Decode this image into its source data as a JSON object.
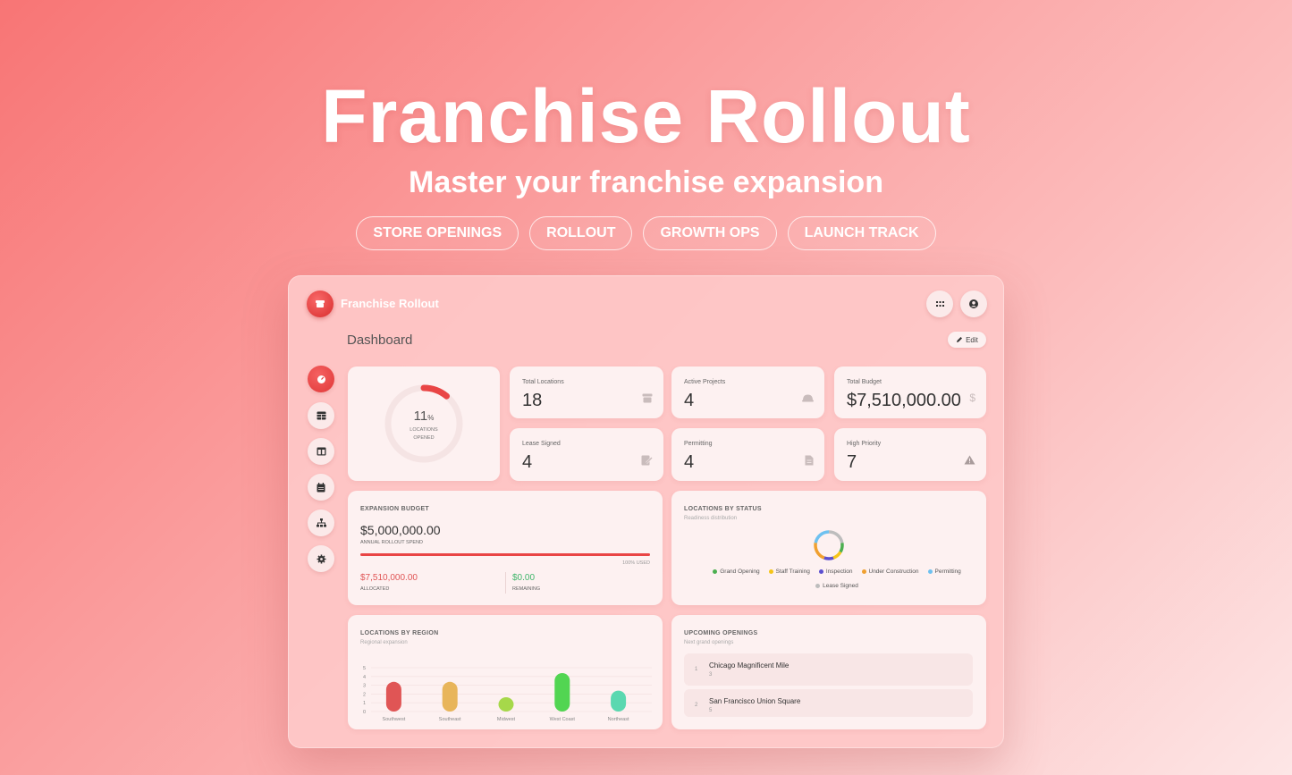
{
  "hero": {
    "title": "Franchise Rollout",
    "subtitle": "Master your franchise expansion",
    "tags": [
      "STORE OPENINGS",
      "ROLLOUT",
      "GROWTH OPS",
      "LAUNCH TRACK"
    ]
  },
  "app": {
    "title": "Franchise Rollout",
    "page_title": "Dashboard",
    "edit_label": "Edit"
  },
  "sidebar": {
    "items": [
      {
        "icon": "dashboard-icon",
        "active": true
      },
      {
        "icon": "table-icon",
        "active": false
      },
      {
        "icon": "board-icon",
        "active": false
      },
      {
        "icon": "calendar-icon",
        "active": false
      },
      {
        "icon": "hierarchy-icon",
        "active": false
      },
      {
        "icon": "settings-icon",
        "active": false
      }
    ]
  },
  "progress": {
    "value": "11",
    "unit": "%",
    "label_line1": "LOCATIONS",
    "label_line2": "OPENED",
    "fraction": 0.11
  },
  "stats": [
    {
      "label": "Total Locations",
      "value": "18",
      "icon": "store-icon"
    },
    {
      "label": "Active Projects",
      "value": "4",
      "icon": "hardhat-icon"
    },
    {
      "label": "Total Budget",
      "value": "$7,510,000.00",
      "icon": "dollar-icon"
    },
    {
      "label": "Lease Signed",
      "value": "4",
      "icon": "signature-icon"
    },
    {
      "label": "Permitting",
      "value": "4",
      "icon": "document-icon"
    },
    {
      "label": "High Priority",
      "value": "7",
      "icon": "warning-icon"
    }
  ],
  "budget": {
    "title": "EXPANSION BUDGET",
    "amount": "$5,000,000.00",
    "amount_label": "ANNUAL ROLLOUT SPEND",
    "used_label": "100% USED",
    "used_fraction": 1.0,
    "allocated": "$7,510,000.00",
    "allocated_label": "ALLOCATED",
    "remaining": "$0.00",
    "remaining_label": "REMAINING"
  },
  "status": {
    "title": "LOCATIONS BY STATUS",
    "subtitle": "Readiness distribution",
    "legend": [
      {
        "label": "Grand Opening",
        "color": "#4caf50"
      },
      {
        "label": "Staff Training",
        "color": "#f5c518"
      },
      {
        "label": "Inspection",
        "color": "#5b4fcf"
      },
      {
        "label": "Under Construction",
        "color": "#f0a030"
      },
      {
        "label": "Permitting",
        "color": "#6ec1f0"
      },
      {
        "label": "Lease Signed",
        "color": "#bdbdbd"
      }
    ]
  },
  "region": {
    "title": "LOCATIONS BY REGION",
    "subtitle": "Regional expansion"
  },
  "openings": {
    "title": "UPCOMING OPENINGS",
    "subtitle": "Next grand openings",
    "items": [
      {
        "num": "1",
        "name": "Chicago Magnificent Mile",
        "sub": "3"
      },
      {
        "num": "2",
        "name": "San Francisco Union Square",
        "sub": "5"
      }
    ]
  },
  "chart_data": [
    {
      "type": "bar",
      "title": "LOCATIONS BY REGION",
      "categories": [
        "Southwest",
        "Southeast",
        "Midwest",
        "West Coast",
        "Northeast"
      ],
      "values": [
        4,
        4,
        2,
        5,
        3
      ],
      "colors": [
        "#e05555",
        "#e8b55a",
        "#a6d84a",
        "#52d552",
        "#5ad8b0"
      ],
      "yticks": [
        "0",
        "1",
        "2",
        "3",
        "4",
        "5"
      ],
      "ylim": [
        0,
        5
      ],
      "grid": true
    },
    {
      "type": "pie",
      "title": "LOCATIONS BY STATUS",
      "categories": [
        "Grand Opening",
        "Staff Training",
        "Inspection",
        "Under Construction",
        "Permitting",
        "Lease Signed"
      ],
      "values": [
        2,
        2,
        2,
        4,
        4,
        4
      ]
    }
  ]
}
